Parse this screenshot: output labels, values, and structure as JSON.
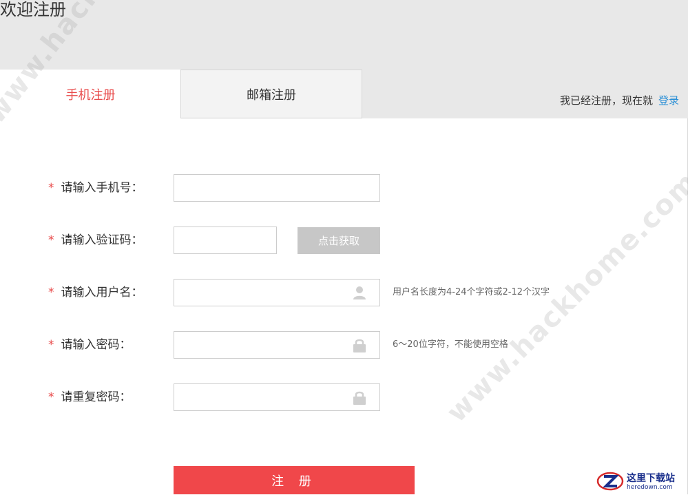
{
  "page": {
    "title": "欢迎注册"
  },
  "tabs": [
    {
      "label": "手机注册",
      "active": true
    },
    {
      "label": "邮箱注册",
      "active": false
    }
  ],
  "login_hint": {
    "text": "我已经注册，现在就",
    "link": "登录"
  },
  "form": {
    "required_mark": "*",
    "phone": {
      "label": "请输入手机号：",
      "value": ""
    },
    "code": {
      "label": "请输入验证码：",
      "value": "",
      "button": "点击获取"
    },
    "username": {
      "label": "请输入用户名：",
      "value": "",
      "icon": "user-icon",
      "hint": "用户名长度为4-24个字符或2-12个汉字"
    },
    "password": {
      "label": "请输入密码：",
      "value": "",
      "icon": "lock-icon",
      "hint": "6～20位字符，不能使用空格"
    },
    "confirm_password": {
      "label": "请重复密码：",
      "value": "",
      "icon": "lock-icon"
    },
    "submit": "注 册"
  },
  "watermark": "www.hackhome.com",
  "corner_logo": {
    "title": "这里下载站",
    "sub": "heredown.com"
  },
  "colors": {
    "accent_red": "#f0474a",
    "tab_active_text": "#e84a4a",
    "link_blue": "#2a8fd6",
    "disabled_button": "#c7c7c7",
    "top_band": "#e8e8e8"
  }
}
